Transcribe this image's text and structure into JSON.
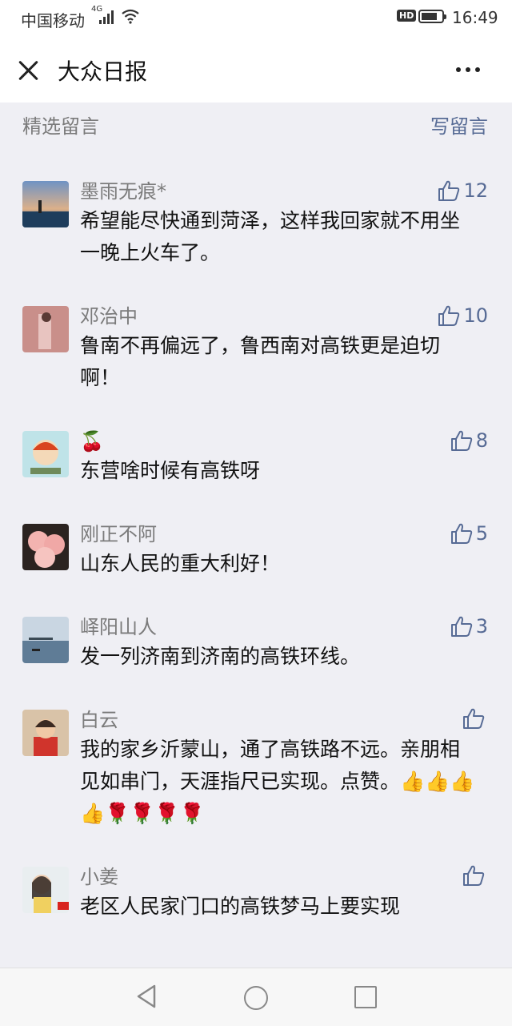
{
  "status": {
    "carrier": "中国移动",
    "network": "4G",
    "hd": "HD",
    "time": "16:49",
    "battery_level": 0.8
  },
  "header": {
    "title": "大众日报",
    "close_icon": "close-icon",
    "more_icon": "more-icon"
  },
  "section": {
    "label": "精选留言",
    "write_label": "写留言"
  },
  "comments": [
    {
      "name": "墨雨无痕*",
      "text": "希望能尽快通到菏泽，这样我回家就不用坐一晚上火车了。",
      "likes": "12"
    },
    {
      "name": "邓治中",
      "text": "鲁南不再偏远了，鲁西南对高铁更是迫切啊！",
      "likes": "10"
    },
    {
      "name": "🍒",
      "text": "东营啥时候有高铁呀",
      "likes": "8"
    },
    {
      "name": "刚正不阿",
      "text": "山东人民的重大利好！",
      "likes": "5"
    },
    {
      "name": "峄阳山人",
      "text": "发一列济南到济南的高铁环线。",
      "likes": "3"
    },
    {
      "name": "白云",
      "text": "我的家乡沂蒙山，通了高铁路不远。亲朋相见如串门，天涯指尺已实现。点赞。👍👍👍👍🌹🌹🌹🌹",
      "likes": ""
    },
    {
      "name": "小姜",
      "text": "老区人民家门口的高铁梦马上要实现",
      "likes": ""
    }
  ],
  "colors": {
    "link": "#576b95",
    "meta": "#7b7b7b",
    "background": "#efeff4"
  }
}
